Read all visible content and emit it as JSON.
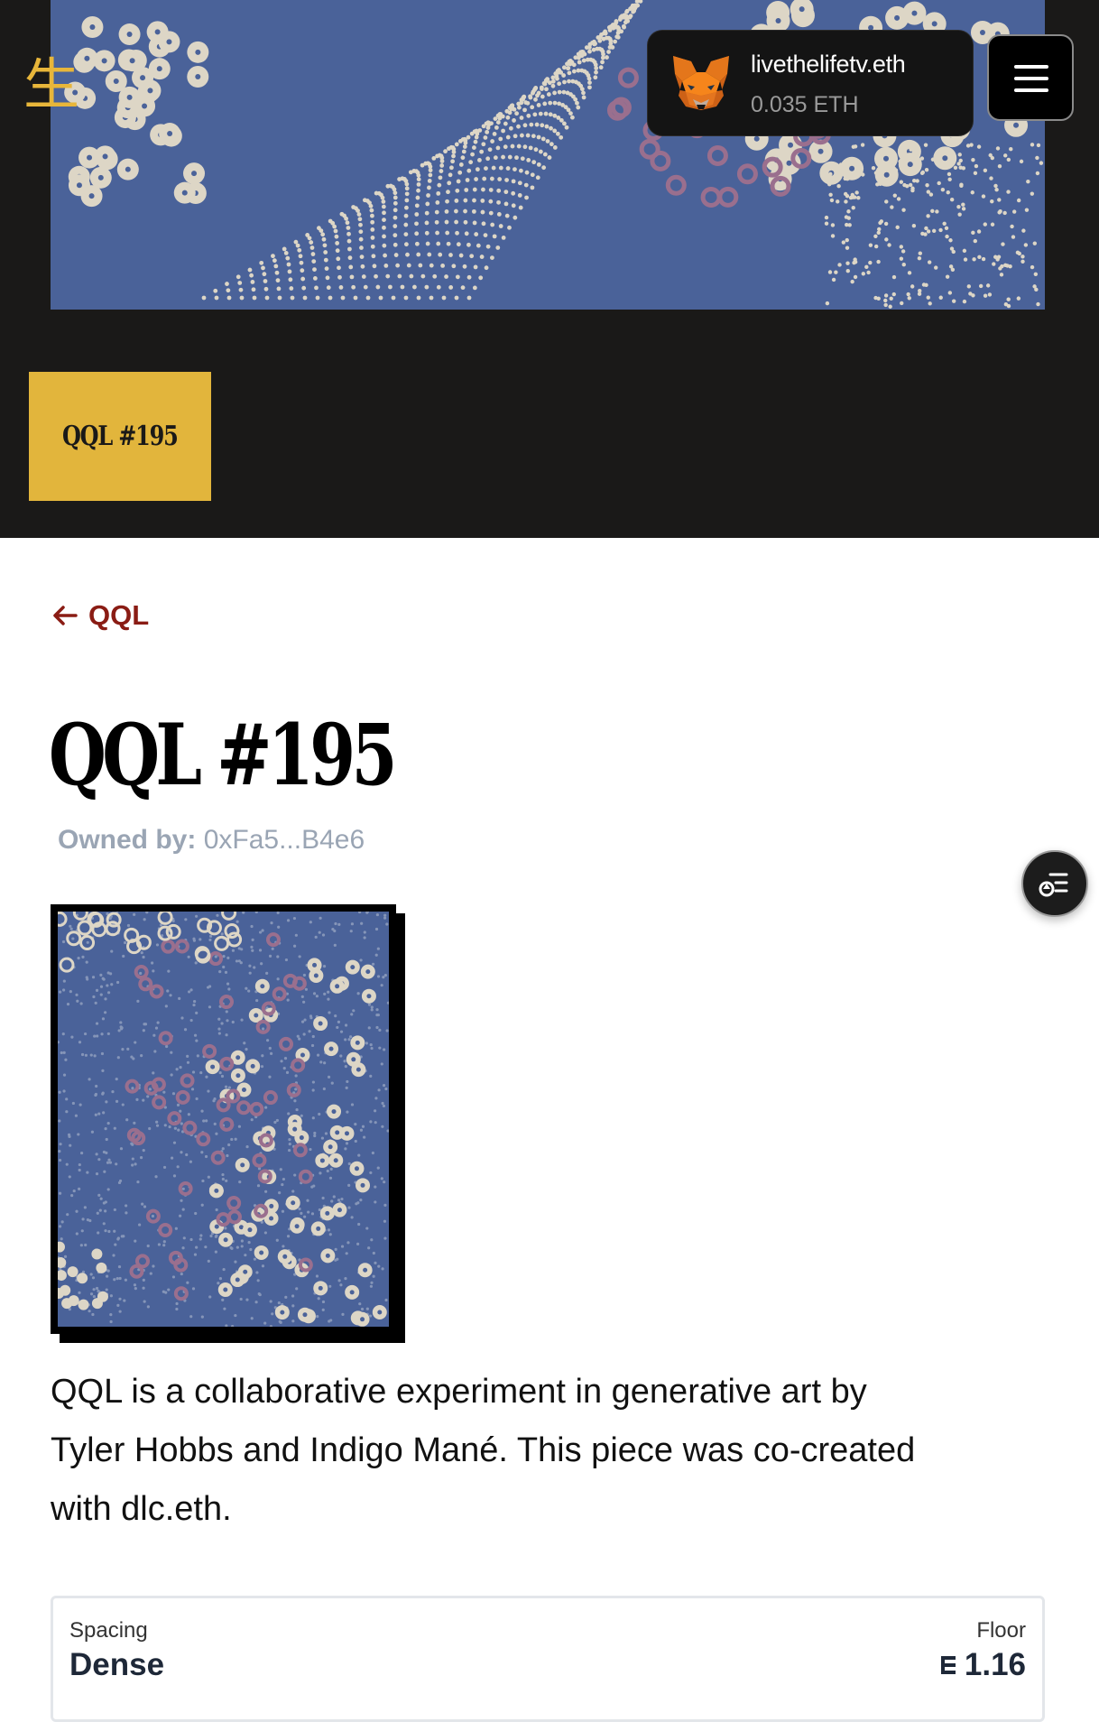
{
  "header": {
    "logo_glyph": "生",
    "wallet": {
      "name": "livethelifetv.eth",
      "balance": "0.035 ETH",
      "icon": "metamask-fox-icon"
    },
    "menu_icon": "hamburger-menu-icon",
    "token_tag": "QQL #195"
  },
  "nav": {
    "back_label": "QQL",
    "back_icon": "arrow-left-icon"
  },
  "token": {
    "title": "QQL #195",
    "owned_by_label": "Owned by:",
    "owner": "0xFa5...B4e6",
    "description": "QQL is a collaborative experiment in generative art by Tyler Hobbs and Indigo Mané. This piece was co-created with dlc.eth."
  },
  "floating_action": {
    "icon": "traits-list-icon"
  },
  "stats": {
    "spacing_label": "Spacing",
    "spacing_value": "Dense",
    "floor_label": "Floor",
    "floor_value": "1.16",
    "floor_icon": "eth-icon"
  },
  "colors": {
    "header_bg": "#1a1918",
    "art_blue": "#4a6299",
    "accent_gold": "#e2b53c",
    "link_red": "#8a1c14",
    "dot_cream": "#ddd6c6",
    "dot_pink": "#9a6f8e"
  }
}
